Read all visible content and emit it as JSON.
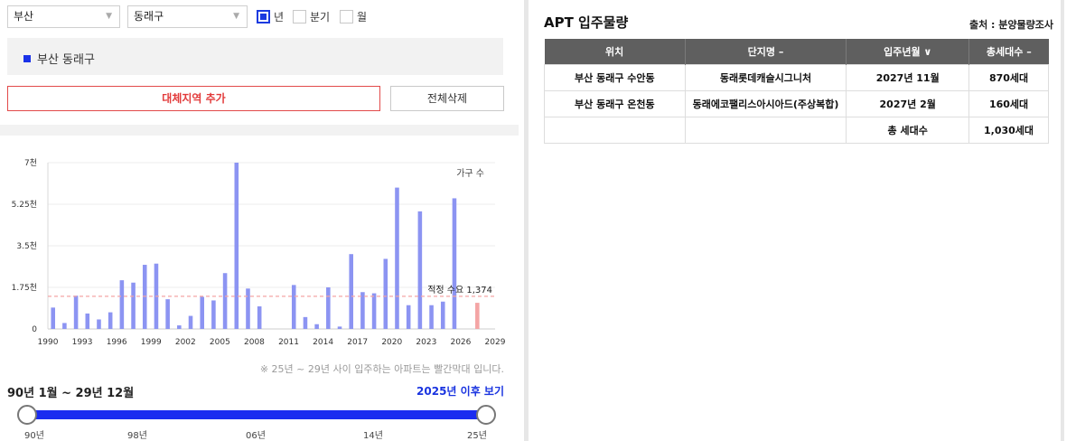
{
  "filters": {
    "city": "부산",
    "district": "동래구",
    "periods": [
      {
        "label": "년",
        "checked": true
      },
      {
        "label": "분기",
        "checked": false
      },
      {
        "label": "월",
        "checked": false
      }
    ]
  },
  "region_list": [
    "부산 동래구"
  ],
  "buttons": {
    "add_region": "대체지역 추가",
    "clear_all": "전체삭제"
  },
  "chart_data": {
    "type": "bar",
    "legend": "가구 수",
    "ylim": [
      0,
      7000
    ],
    "yticks": [
      {
        "value": 0,
        "label": "0"
      },
      {
        "value": 1750,
        "label": "1.75천"
      },
      {
        "value": 3500,
        "label": "3.5천"
      },
      {
        "value": 5250,
        "label": "5.25천"
      },
      {
        "value": 7000,
        "label": "7천"
      }
    ],
    "xlim": [
      1990,
      2029
    ],
    "xticks": [
      1990,
      1993,
      1996,
      1999,
      2002,
      2005,
      2008,
      2011,
      2014,
      2017,
      2020,
      2023,
      2026,
      2029
    ],
    "years": [
      1990,
      1991,
      1992,
      1993,
      1994,
      1995,
      1996,
      1997,
      1998,
      1999,
      2000,
      2001,
      2002,
      2003,
      2004,
      2005,
      2006,
      2007,
      2008,
      2009,
      2010,
      2011,
      2012,
      2013,
      2014,
      2015,
      2016,
      2017,
      2018,
      2019,
      2020,
      2021,
      2022,
      2023,
      2024,
      2025,
      2026,
      2027
    ],
    "values": [
      900,
      250,
      1400,
      650,
      400,
      700,
      2050,
      1950,
      2700,
      2750,
      1250,
      150,
      550,
      1350,
      1200,
      2350,
      7000,
      1700,
      950,
      0,
      0,
      1850,
      500,
      200,
      1750,
      100,
      3150,
      1550,
      1500,
      2950,
      5950,
      1000,
      4950,
      1000,
      1150,
      5500,
      0,
      1100
    ],
    "highlight_years": [
      2027
    ],
    "bar_color": "#8c94f2",
    "highlight_color": "#f4a5a5",
    "reference_line": {
      "value": 1374,
      "label": "적정 수요 1,374",
      "color": "#f4a5a5"
    }
  },
  "note": "※ 25년 ~ 29년 사이 입주하는 아파트는 빨간막대 입니다.",
  "range": {
    "title": "90년 1월 ~ 29년 12월",
    "link": "2025년 이후 보기",
    "ticks": [
      "90년",
      "98년",
      "06년",
      "14년",
      "25년"
    ]
  },
  "apt": {
    "title": "APT 입주물량",
    "source": "출처 : 분양물량조사",
    "headers": [
      "위치",
      "단지명 –",
      "입주년월 ∨",
      "총세대수 –"
    ],
    "rows": [
      [
        "부산 동래구 수안동",
        "동래롯데캐슬시그니처",
        "2027년 11월",
        "870세대"
      ],
      [
        "부산 동래구 온천동",
        "동래에코팰리스아시아드(주상복합)",
        "2027년 2월",
        "160세대"
      ]
    ],
    "total_label": "총 세대수",
    "total_value": "1,030세대"
  }
}
